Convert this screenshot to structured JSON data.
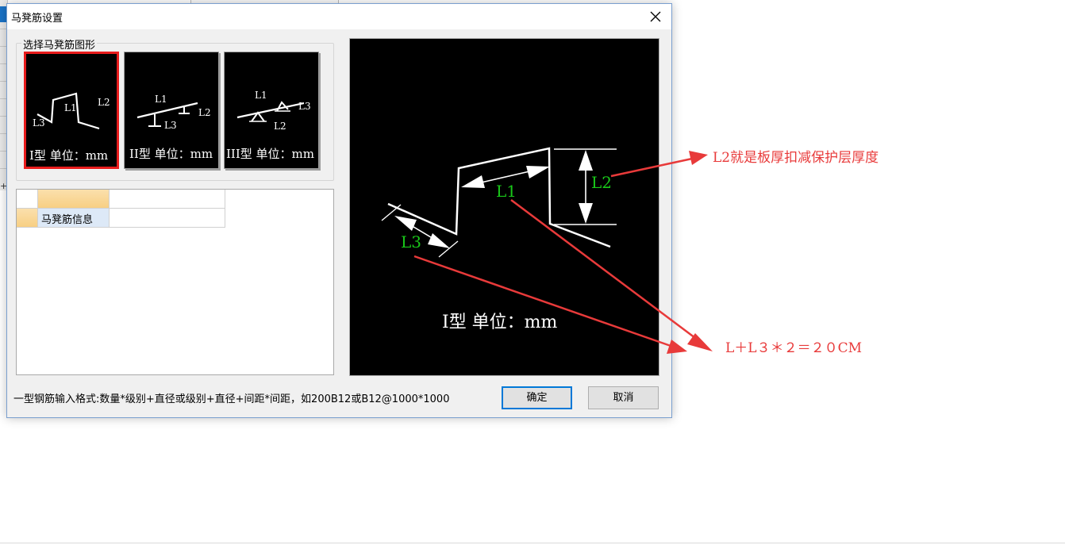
{
  "dialog": {
    "title": "马凳筋设置",
    "group_label": "选择马凳筋图形",
    "shapes": [
      {
        "caption": "I型 单位：mm",
        "selected": true
      },
      {
        "caption": "II型 单位：mm",
        "selected": false
      },
      {
        "caption": "III型 单位：mm",
        "selected": false
      }
    ],
    "grid": {
      "row_label": "马凳筋信息",
      "row_value": ""
    },
    "preview": {
      "label_l1": "L1",
      "label_l2": "L2",
      "label_l3": "L3",
      "caption": "I型 单位：mm"
    },
    "hint": "一型钢筋输入格式:数量*级别+直径或级别+直径+间距*间距，如200B12或B12@1000*1000",
    "ok_label": "确定",
    "cancel_label": "取消"
  },
  "shape_labels": {
    "l1": "L1",
    "l2": "L2",
    "l3": "L3"
  },
  "annotations": {
    "top": "L2就是板厚扣减保护层厚度",
    "bottom": "L＋L３＊２＝２０CM"
  },
  "colors": {
    "annotation": "#e83a3a",
    "selected_border": "#e81c1c",
    "dim_label": "#19c819",
    "primary_border": "#0078d7"
  }
}
